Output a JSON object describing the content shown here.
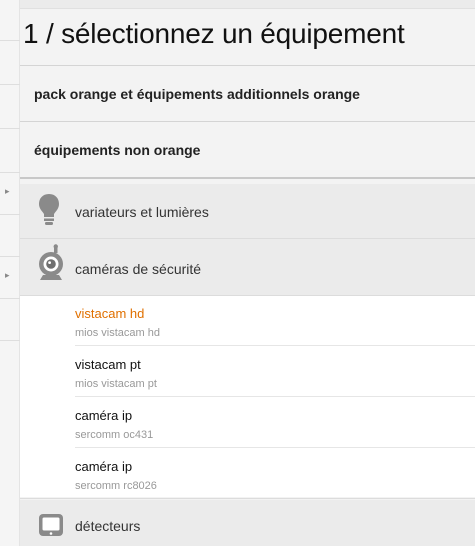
{
  "title": "1 / sélectionnez un équipement",
  "categories": [
    {
      "label": "pack orange et équipements additionnels orange"
    },
    {
      "label": "équipements non orange"
    }
  ],
  "device_types": [
    {
      "label": "variateurs et lumières",
      "icon": "lightbulb-icon"
    },
    {
      "label": "caméras de sécurité",
      "icon": "security-camera-icon"
    },
    {
      "label": "détecteurs",
      "icon": "detector-icon"
    }
  ],
  "devices": [
    {
      "name": "vistacam hd",
      "model": "mios vistacam hd",
      "selected": true
    },
    {
      "name": "vistacam pt",
      "model": "mios vistacam pt",
      "selected": false
    },
    {
      "name": "caméra ip",
      "model": "sercomm oc431",
      "selected": false
    },
    {
      "name": "caméra ip",
      "model": "sercomm rc8026",
      "selected": false
    }
  ],
  "colors": {
    "accent": "#e07000",
    "icon": "#8a8a8a"
  }
}
